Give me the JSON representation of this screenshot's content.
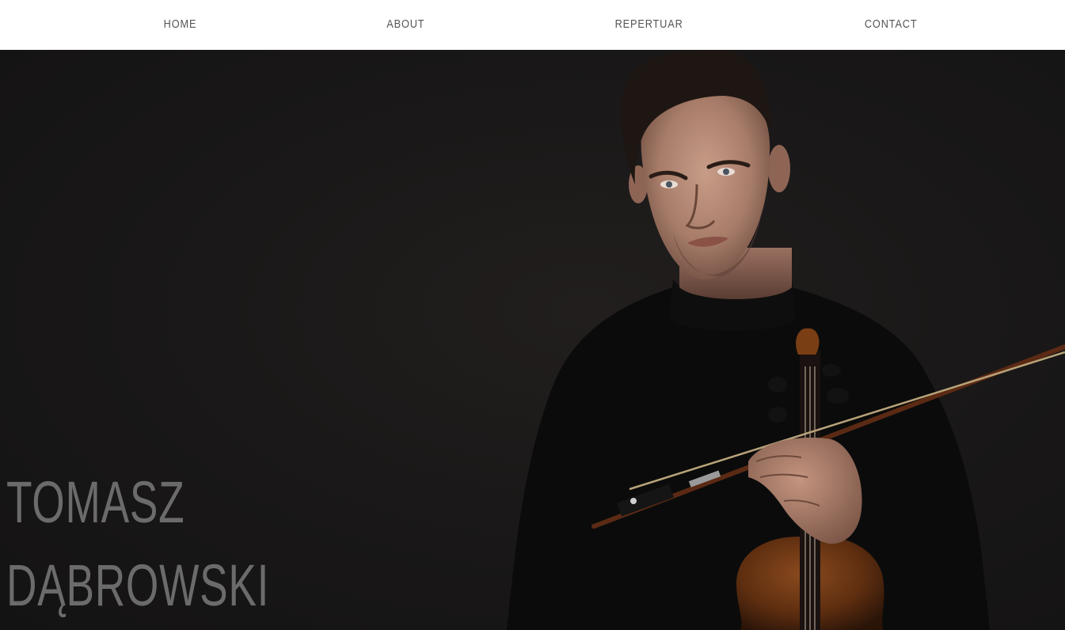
{
  "nav": {
    "items": [
      {
        "label": "HOME"
      },
      {
        "label": "ABOUT"
      },
      {
        "label": "REPERTUAR"
      },
      {
        "label": "CONTACT"
      }
    ]
  },
  "hero": {
    "first_name": "TOMASZ",
    "last_name": "DĄBROWSKI"
  },
  "colors": {
    "nav_background": "#ffffff",
    "nav_text": "#555555",
    "hero_background": "#1a1818",
    "name_text": "#6b6b6b"
  }
}
